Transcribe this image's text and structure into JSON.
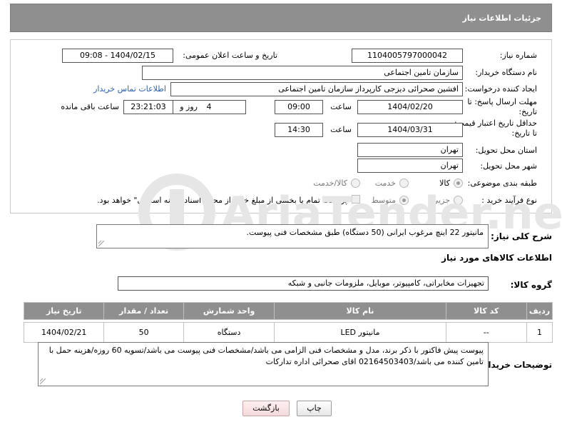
{
  "header": {
    "title": "جزئیات اطلاعات نیاز"
  },
  "form": {
    "need_number": {
      "label": "شماره نیاز:",
      "value": "1104005797000042"
    },
    "announce_datetime": {
      "label": "تاریخ و ساعت اعلان عمومی:",
      "value": "1404/02/15 - 09:08"
    },
    "buyer_org": {
      "label": "نام دستگاه خریدار:",
      "value": "سازمان تامین اجتماعی"
    },
    "requester": {
      "label": "ایجاد کننده درخواست:",
      "value": "افشین صحرائی دیزجی کارپرداز سازمان تامین اجتماعی",
      "contact_link": "اطلاعات تماس خریدار"
    },
    "reply_deadline": {
      "label_line1": "مهلت ارسال پاسخ: تا",
      "label_line2": "تاریخ:",
      "date": "1404/02/20",
      "time_label": "ساعت",
      "time": "09:00",
      "days": "4",
      "days_label": "روز و",
      "remaining_time": "23:21:03",
      "remaining_label": "ساعت باقی مانده"
    },
    "price_validity": {
      "label_line1": "حداقل تاریخ اعتبار قیمت:",
      "label_line2": "تا تاریخ:",
      "date": "1404/03/31",
      "time_label": "ساعت",
      "time": "14:30"
    },
    "delivery_province": {
      "label": "استان محل تحویل:",
      "value": "تهران"
    },
    "delivery_city": {
      "label": "شهر محل تحویل:",
      "value": "تهران"
    },
    "category": {
      "label": "طبقه بندی موضوعی:",
      "options": [
        "کالا",
        "خدمت",
        "کالا/خدمت"
      ],
      "selected": "کالا"
    },
    "process_type": {
      "label": "نوع فرآیند خرید :",
      "options": [
        "جزیی",
        "متوسط"
      ],
      "selected": "متوسط",
      "payment_note": "پرداخت تمام یا بخشی از مبلغ خرید،از محل \"اسناد خزانه اسلامی\" خواهد بود."
    }
  },
  "description": {
    "label": "شرح کلی نیاز:",
    "value": "مانیتور 22 اینچ مرغوب ایرانی (50 دستگاه) طبق مشخصات فنی پیوست."
  },
  "goods_info": {
    "title": "اطلاعات کالاهای مورد نیاز",
    "group_label": "گروه کالا:",
    "group_value": "تجهیزات مخابراتی، کامپیوتر، موبایل، ملزومات جانبی و شبکه"
  },
  "table": {
    "headers": [
      "ردیف",
      "کد کالا",
      "نام کالا",
      "واحد شمارش",
      "تعداد / مقدار",
      "تاریخ نیاز"
    ],
    "rows": [
      [
        "1",
        "--",
        "مانیتور LED",
        "دستگاه",
        "50",
        "1404/02/21"
      ]
    ]
  },
  "buyer_notes": {
    "label": "توضیحات خریدار:",
    "value": "پیوست پیش فاکتور با ذکر برند، مدل و مشخصات فنی الزامی می باشد/مشخصات فنی پیوست می باشد/تسویه 60 روزه/هزینه حمل با تامین کننده می باشد/02164503403 اقای صحرائی اداره تدارکات"
  },
  "buttons": {
    "print": "چاپ",
    "back": "بازگشت"
  },
  "watermark": {
    "text": "AriaTender.net",
    "color": "#e3e3e3"
  },
  "colors": {
    "header_bg": "#8f8f8f",
    "link": "#2b63b8",
    "back_button_bg": "#f4dada"
  }
}
